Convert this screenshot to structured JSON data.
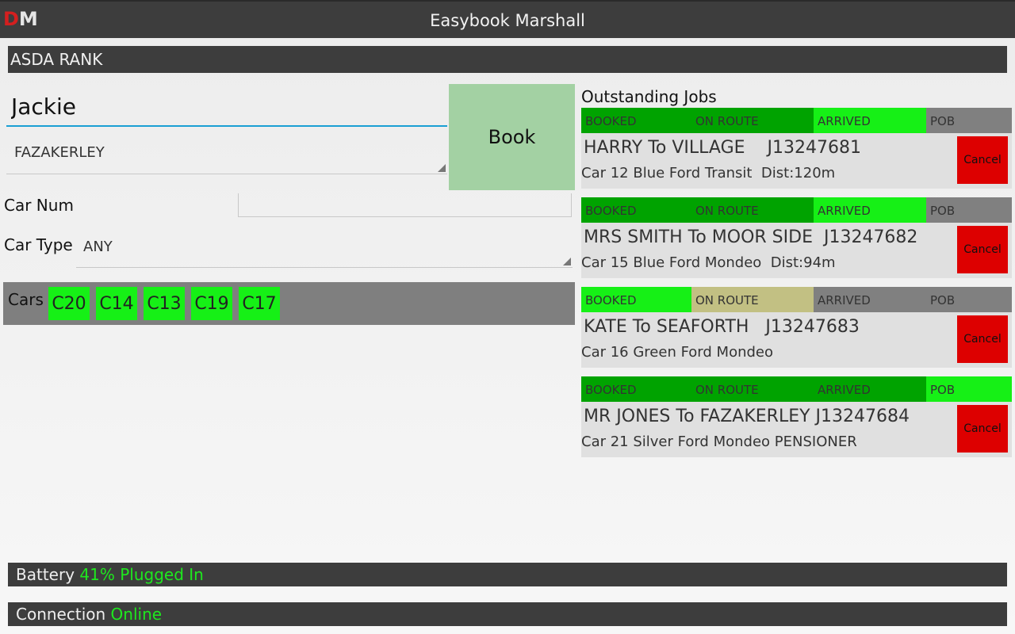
{
  "app": {
    "logo_d": "D",
    "logo_m": "M",
    "title": "Easybook Marshall"
  },
  "rank": {
    "name": "ASDA RANK"
  },
  "booking": {
    "name_value": "Jackie",
    "destination": "FAZAKERLEY",
    "book_label": "Book",
    "car_num_label": "Car Num",
    "car_num_value": "",
    "car_type_label": "Car Type",
    "car_type_value": "ANY"
  },
  "cars": {
    "label": "Cars",
    "items": [
      "C20",
      "C14",
      "C13",
      "C19",
      "C17"
    ]
  },
  "jobs": {
    "heading": "Outstanding Jobs",
    "stages": [
      "BOOKED",
      "ON ROUTE",
      "ARRIVED",
      "POB"
    ],
    "cancel_label": "Cancel",
    "items": [
      {
        "line1": "HARRY To VILLAGE    J13247681",
        "line2": "Car 12 Blue Ford Transit  Dist:120m",
        "stage_colors": [
          "#00a300",
          "#00a300",
          "#16f016",
          "#808080"
        ]
      },
      {
        "line1": "MRS SMITH To MOOR SIDE  J13247682",
        "line2": "Car 15 Blue Ford Mondeo  Dist:94m",
        "stage_colors": [
          "#00a300",
          "#00a300",
          "#16f016",
          "#808080"
        ]
      },
      {
        "line1": "KATE To SEAFORTH   J13247683",
        "line2": "Car 16 Green Ford Mondeo",
        "stage_colors": [
          "#16f016",
          "#c2c083",
          "#808080",
          "#808080"
        ]
      },
      {
        "line1": "MR JONES To FAZAKERLEY J13247684",
        "line2": "Car 21 Silver Ford Mondeo PENSIONER",
        "stage_colors": [
          "#00a300",
          "#00a300",
          "#00a300",
          "#16f016"
        ]
      }
    ]
  },
  "status": {
    "battery_label": "Battery",
    "battery_value": "41% Plugged In",
    "connection_label": "Connection",
    "connection_value": "Online"
  },
  "colors": {
    "header_bg": "#3d3d3d",
    "accent_green": "#16f016",
    "dark_green": "#00a300",
    "book_button": "#a3d1a3",
    "cancel_red": "#dd0000"
  }
}
